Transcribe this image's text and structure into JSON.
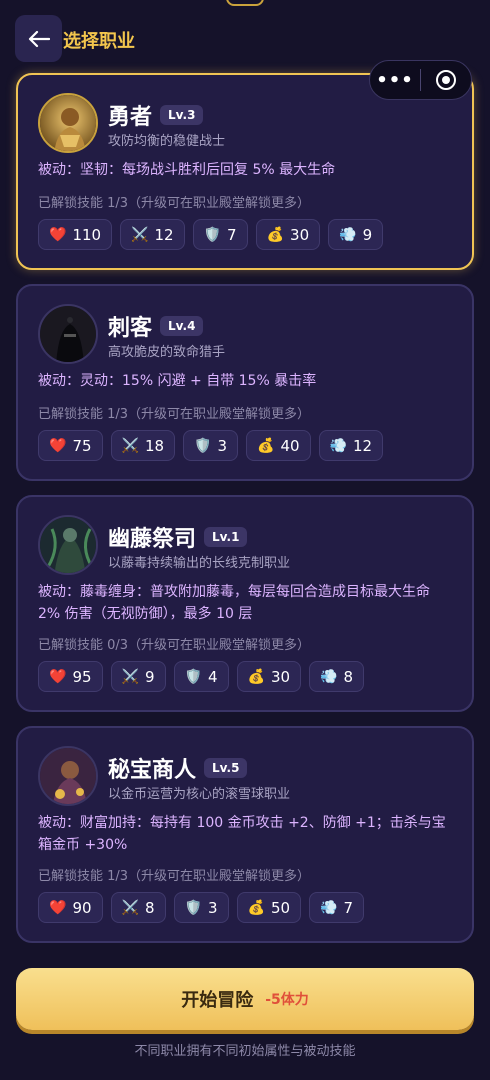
{
  "header": {
    "back_icon": "arrow-left-icon",
    "title": "选择职业"
  },
  "capsule": {
    "more_icon": "more-dots-icon",
    "more_label": "•••",
    "close_icon": "target-ring-icon"
  },
  "colors": {
    "accent": "#f0c454",
    "passive_text": "#dcb4ff",
    "background": "#15122a",
    "card_bg": "#221c44",
    "cost": "#e0503a"
  },
  "classes": [
    {
      "name": "勇者",
      "level": "Lv.3",
      "subtitle": "攻防均衡的稳健战士",
      "passive": "被动：坚韧：每场战斗胜利后回复 5% 最大生命",
      "unlock": "已解锁技能 1/3（升级可在职业殿堂解锁更多）",
      "selected": true,
      "stats": [
        {
          "icon": "❤️",
          "value": "110"
        },
        {
          "icon": "⚔️",
          "value": "12"
        },
        {
          "icon": "🛡️",
          "value": "7"
        },
        {
          "icon": "💰",
          "value": "30"
        },
        {
          "icon": "💨",
          "value": "9"
        }
      ]
    },
    {
      "name": "刺客",
      "level": "Lv.4",
      "subtitle": "高攻脆皮的致命猎手",
      "passive": "被动：灵动：15% 闪避 + 自带 15% 暴击率",
      "unlock": "已解锁技能 1/3（升级可在职业殿堂解锁更多）",
      "selected": false,
      "stats": [
        {
          "icon": "❤️",
          "value": "75"
        },
        {
          "icon": "⚔️",
          "value": "18"
        },
        {
          "icon": "🛡️",
          "value": "3"
        },
        {
          "icon": "💰",
          "value": "40"
        },
        {
          "icon": "💨",
          "value": "12"
        }
      ]
    },
    {
      "name": "幽藤祭司",
      "level": "Lv.1",
      "subtitle": "以藤毒持续输出的长线克制职业",
      "passive": "被动：藤毒缠身：普攻附加藤毒，每层每回合造成目标最大生命 2% 伤害（无视防御），最多 10 层",
      "unlock": "已解锁技能 0/3（升级可在职业殿堂解锁更多）",
      "selected": false,
      "stats": [
        {
          "icon": "❤️",
          "value": "95"
        },
        {
          "icon": "⚔️",
          "value": "9"
        },
        {
          "icon": "🛡️",
          "value": "4"
        },
        {
          "icon": "💰",
          "value": "30"
        },
        {
          "icon": "💨",
          "value": "8"
        }
      ]
    },
    {
      "name": "秘宝商人",
      "level": "Lv.5",
      "subtitle": "以金币运营为核心的滚雪球职业",
      "passive": "被动：财富加持：每持有 100 金币攻击 +2、防御 +1；击杀与宝箱金币 +30%",
      "unlock": "已解锁技能 1/3（升级可在职业殿堂解锁更多）",
      "selected": false,
      "stats": [
        {
          "icon": "❤️",
          "value": "90"
        },
        {
          "icon": "⚔️",
          "value": "8"
        },
        {
          "icon": "🛡️",
          "value": "3"
        },
        {
          "icon": "💰",
          "value": "50"
        },
        {
          "icon": "💨",
          "value": "7"
        }
      ]
    }
  ],
  "start_button": {
    "label": "开始冒险",
    "cost": "-5体力"
  },
  "footer": {
    "note": "不同职业拥有不同初始属性与被动技能"
  }
}
